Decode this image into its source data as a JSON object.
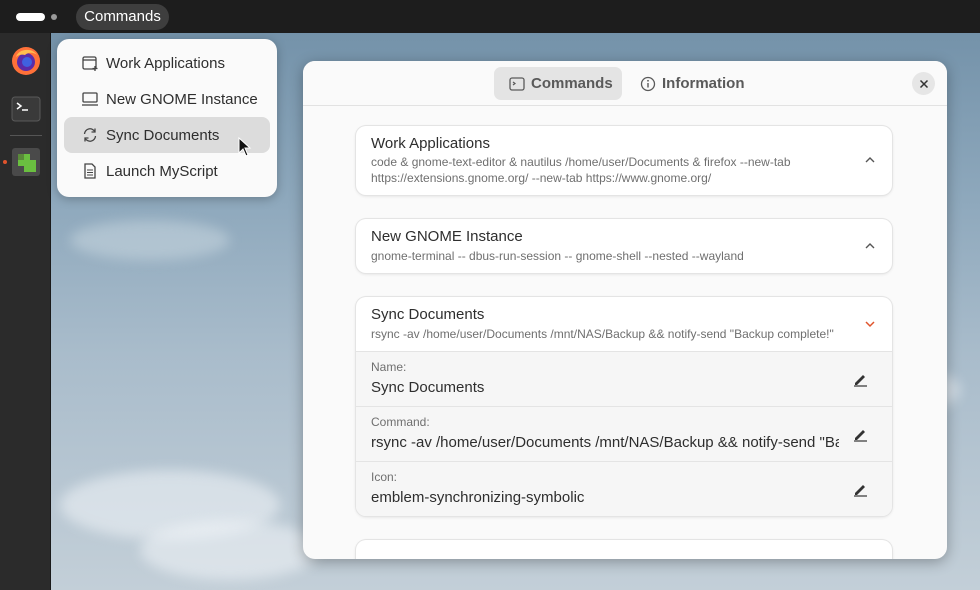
{
  "topbar": {
    "app_label": "Commands"
  },
  "dock": {
    "items": [
      "firefox-icon",
      "terminal-icon",
      "extensions-icon"
    ]
  },
  "popup_menu": {
    "items": [
      {
        "label": "Work Applications",
        "icon": "window-new-icon"
      },
      {
        "label": "New GNOME Instance",
        "icon": "computer-icon"
      },
      {
        "label": "Sync Documents",
        "icon": "sync-icon"
      },
      {
        "label": "Launch MyScript",
        "icon": "document-icon"
      }
    ]
  },
  "window": {
    "tabs": [
      {
        "label": "Commands",
        "icon": "terminal-small-icon"
      },
      {
        "label": "Information",
        "icon": "info-icon"
      }
    ],
    "commands": [
      {
        "title": "Work Applications",
        "command": "code & gnome-text-editor & nautilus /home/user/Documents & firefox --new-tab https://extensions.gnome.org/ --new-tab https://www.gnome.org/"
      },
      {
        "title": "New GNOME Instance",
        "command": "gnome-terminal -- dbus-run-session -- gnome-shell --nested --wayland"
      },
      {
        "title": "Sync Documents",
        "command": "rsync -av /home/user/Documents /mnt/NAS/Backup && notify-send \"Backup complete!\"",
        "fields": [
          {
            "label": "Name:",
            "value": "Sync Documents"
          },
          {
            "label": "Command:",
            "value": "rsync -av /home/user/Documents /mnt/NAS/Backup && notify-send \"Backup complete!\""
          },
          {
            "label": "Icon:",
            "value": "emblem-synchronizing-symbolic"
          }
        ]
      }
    ]
  },
  "colors": {
    "accent": "#e0542c",
    "topbar": "#1d1d1d",
    "dock": "#2b2b2b"
  }
}
